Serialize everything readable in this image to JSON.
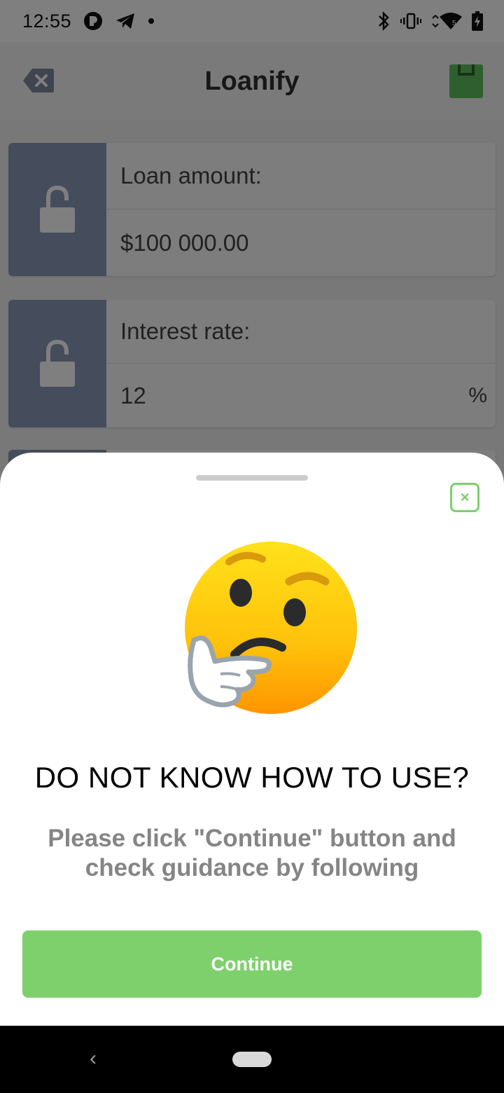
{
  "status_bar": {
    "time": "12:55",
    "left_icons": [
      "app-notification-icon",
      "telegram-icon",
      "dot-icon"
    ],
    "right_icons": [
      "bluetooth-icon",
      "vibrate-icon",
      "wifi-icon",
      "battery-icon"
    ]
  },
  "app_bar": {
    "title": "Loanify",
    "back_icon": "backspace-icon",
    "save_icon": "save-icon",
    "save_color": "#5fbf5c"
  },
  "cards": [
    {
      "label": "Loan amount:",
      "value": "$100 000.00",
      "unit": "",
      "lock_icon": "unlock-icon"
    },
    {
      "label": "Interest rate:",
      "value": "12",
      "unit": "%",
      "lock_icon": "unlock-icon"
    }
  ],
  "sheet": {
    "emoji_icon": "thinking-face-icon",
    "close_icon": "close-icon",
    "close_label": "×",
    "title": "DO NOT KNOW HOW TO USE?",
    "description": "Please click \"Continue\" button and check guidance by following",
    "continue_label": "Continue",
    "accent_color": "#7ed06c"
  },
  "nav_bar": {
    "back_label": "‹",
    "back_icon": "nav-back-icon",
    "home_icon": "nav-home-pill"
  }
}
